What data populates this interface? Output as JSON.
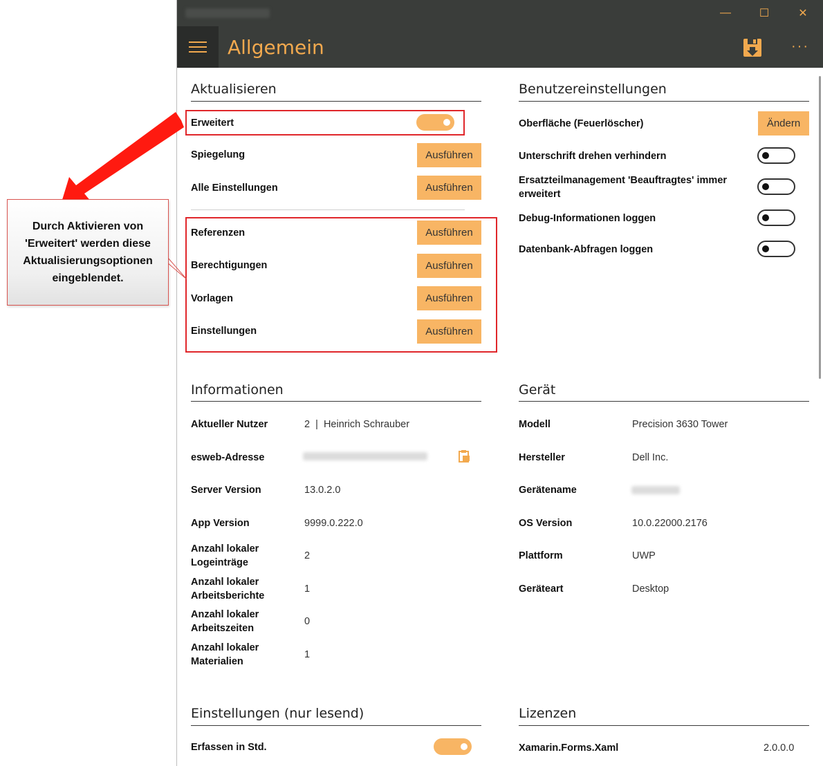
{
  "window": {
    "controls": {
      "minimize": "—",
      "maximize": "☐",
      "close": "✕"
    }
  },
  "header": {
    "title": "Allgemein",
    "more": "···"
  },
  "update": {
    "title": "Aktualisieren",
    "expanded_label": "Erweitert",
    "expanded_on": true,
    "items": [
      {
        "label": "Spiegelung",
        "button": "Ausführen"
      },
      {
        "label": "Alle Einstellungen",
        "button": "Ausführen"
      }
    ],
    "advanced_items": [
      {
        "label": "Referenzen",
        "button": "Ausführen"
      },
      {
        "label": "Berechtigungen",
        "button": "Ausführen"
      },
      {
        "label": "Vorlagen",
        "button": "Ausführen"
      },
      {
        "label": "Einstellungen",
        "button": "Ausführen"
      }
    ]
  },
  "user_settings": {
    "title": "Benutzereinstellungen",
    "surface_label": "Oberfläche (Feuerlöscher)",
    "surface_button": "Ändern",
    "toggles": [
      {
        "label": "Unterschrift drehen verhindern",
        "on": false
      },
      {
        "label": "Ersatzteilmanagement 'Beauftragtes' immer erweitert",
        "on": false
      },
      {
        "label": "Debug-Informationen loggen",
        "on": false
      },
      {
        "label": "Datenbank-Abfragen loggen",
        "on": false
      }
    ]
  },
  "info": {
    "title": "Informationen",
    "rows": [
      {
        "label": "Aktueller Nutzer",
        "value": "2  |  Heinrich Schrauber"
      },
      {
        "label": "esweb-Adresse",
        "value": ""
      },
      {
        "label": "Server Version",
        "value": "13.0.2.0"
      },
      {
        "label": "App Version",
        "value": "9999.0.222.0"
      },
      {
        "label": "Anzahl lokaler Logeinträge",
        "value": "2"
      },
      {
        "label": "Anzahl lokaler Arbeitsberichte",
        "value": "1"
      },
      {
        "label": "Anzahl lokaler Arbeitszeiten",
        "value": "0"
      },
      {
        "label": "Anzahl lokaler Materialien",
        "value": "1"
      }
    ]
  },
  "device": {
    "title": "Gerät",
    "rows": [
      {
        "label": "Modell",
        "value": "Precision 3630 Tower"
      },
      {
        "label": "Hersteller",
        "value": "Dell Inc."
      },
      {
        "label": "Gerätename",
        "value": ""
      },
      {
        "label": "OS Version",
        "value": "10.0.22000.2176"
      },
      {
        "label": "Plattform",
        "value": "UWP"
      },
      {
        "label": "Geräteart",
        "value": "Desktop"
      }
    ]
  },
  "readonly_settings": {
    "title": "Einstellungen (nur lesend)",
    "rows": [
      {
        "label": "Erfassen in Std.",
        "on": true
      }
    ]
  },
  "licenses": {
    "title": "Lizenzen",
    "rows": [
      {
        "label": "Xamarin.Forms.Xaml",
        "value": "2.0.0.0"
      }
    ]
  },
  "callout": {
    "text": "Durch Aktivieren von 'Erweitert' werden diese Aktualisierungsoptionen eingeblendet."
  },
  "colors": {
    "accent": "#f8b564",
    "header_bg": "#3a3d3a",
    "title_accent": "#f2a94e",
    "annotation_red": "#e0262a"
  }
}
